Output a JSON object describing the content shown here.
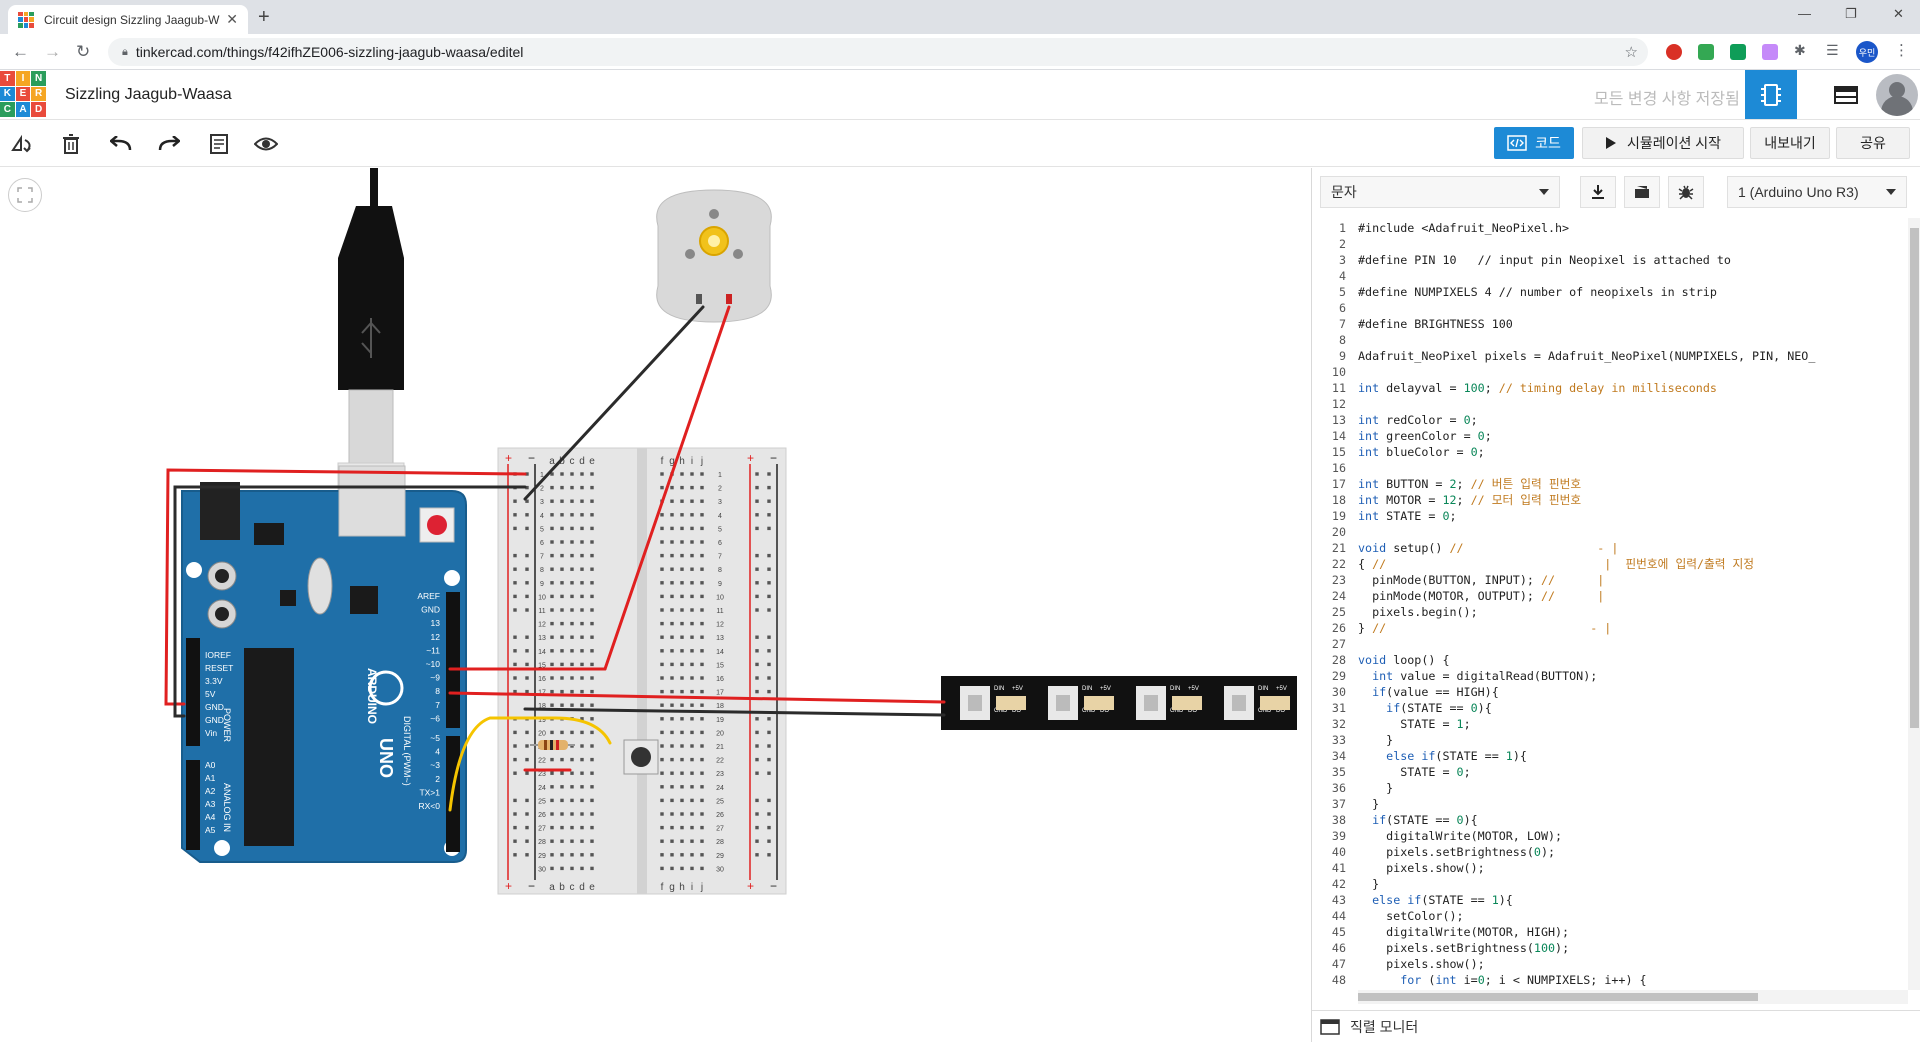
{
  "browser": {
    "tab_title": "Circuit design Sizzling Jaagub-W",
    "url": "tinkercad.com/things/f42ifhZE006-sizzling-jaagub-waasa/editel"
  },
  "header": {
    "logo_letters": [
      "T",
      "I",
      "N",
      "K",
      "E",
      "R",
      "C",
      "A",
      "D"
    ],
    "project_name": "Sizzling Jaagub-Waasa",
    "save_status": "모든 변경 사항 저장됨",
    "profile_badge": "우민"
  },
  "toolbar": {
    "code_label": "코드",
    "simulate_label": "시뮬레이션 시작",
    "export_label": "내보내기",
    "share_label": "공유"
  },
  "code_panel": {
    "mode_select": "문자",
    "device_select": "1 (Arduino Uno R3)",
    "serial_monitor": "직렬 모니터"
  },
  "circuit": {
    "arduino": {
      "brand": "ARDUINO",
      "model": "UNO",
      "power_labels": [
        "IOREF",
        "RESET",
        "3.3V",
        "5V",
        "GND",
        "GND",
        "Vin"
      ],
      "analog_labels": [
        "A0",
        "A1",
        "A2",
        "A3",
        "A4",
        "A5"
      ],
      "digital_labels": [
        "AREF",
        "GND",
        "13",
        "12",
        "~11",
        "~10",
        "~9",
        "8",
        "7",
        "~6",
        "~5",
        "4",
        "~3",
        "2",
        "TX>1",
        "RX<0"
      ],
      "power_caption": "POWER",
      "analog_caption": "ANALOG IN",
      "digital_caption": "DIGITAL (PWM~)"
    },
    "breadboard": {
      "cols_left": [
        "a",
        "b",
        "c",
        "d",
        "e"
      ],
      "cols_right": [
        "f",
        "g",
        "h",
        "i",
        "j"
      ],
      "rows": 30
    },
    "neopixel_pins": [
      "DIN",
      "+5V",
      "GND",
      "DO"
    ]
  },
  "code_lines": [
    [
      {
        "t": "#include <Adafruit_NeoPixel.h>",
        "c": ""
      }
    ],
    [],
    [
      {
        "t": "#define PIN 10   // input pin Neopixel is attached to",
        "c": ""
      }
    ],
    [],
    [
      {
        "t": "#define NUMPIXELS 4 // number of neopixels in strip",
        "c": ""
      }
    ],
    [],
    [
      {
        "t": "#define BRIGHTNESS 100",
        "c": ""
      }
    ],
    [],
    [
      {
        "t": "Adafruit_NeoPixel pixels = Adafruit_NeoPixel(NUMPIXELS, PIN, NEO_",
        "c": ""
      }
    ],
    [],
    [
      {
        "t": "int",
        "c": "kw"
      },
      {
        "t": " delayval = ",
        "c": ""
      },
      {
        "t": "100",
        "c": "num"
      },
      {
        "t": "; ",
        "c": ""
      },
      {
        "t": "// timing delay in milliseconds",
        "c": "cm"
      }
    ],
    [],
    [
      {
        "t": "int",
        "c": "kw"
      },
      {
        "t": " redColor = ",
        "c": ""
      },
      {
        "t": "0",
        "c": "num"
      },
      {
        "t": ";",
        "c": ""
      }
    ],
    [
      {
        "t": "int",
        "c": "kw"
      },
      {
        "t": " greenColor = ",
        "c": ""
      },
      {
        "t": "0",
        "c": "num"
      },
      {
        "t": ";",
        "c": ""
      }
    ],
    [
      {
        "t": "int",
        "c": "kw"
      },
      {
        "t": " blueColor = ",
        "c": ""
      },
      {
        "t": "0",
        "c": "num"
      },
      {
        "t": ";",
        "c": ""
      }
    ],
    [],
    [
      {
        "t": "int",
        "c": "kw"
      },
      {
        "t": " BUTTON = ",
        "c": ""
      },
      {
        "t": "2",
        "c": "num"
      },
      {
        "t": "; ",
        "c": ""
      },
      {
        "t": "// 버튼 입력 핀번호",
        "c": "cm"
      }
    ],
    [
      {
        "t": "int",
        "c": "kw"
      },
      {
        "t": " MOTOR = ",
        "c": ""
      },
      {
        "t": "12",
        "c": "num"
      },
      {
        "t": "; ",
        "c": ""
      },
      {
        "t": "// 모터 입력 핀번호",
        "c": "cm"
      }
    ],
    [
      {
        "t": "int",
        "c": "kw"
      },
      {
        "t": " STATE = ",
        "c": ""
      },
      {
        "t": "0",
        "c": "num"
      },
      {
        "t": ";",
        "c": ""
      }
    ],
    [],
    [
      {
        "t": "void",
        "c": "kw"
      },
      {
        "t": " setup() ",
        "c": ""
      },
      {
        "t": "//                   - |",
        "c": "cm"
      }
    ],
    [
      {
        "t": "{ ",
        "c": ""
      },
      {
        "t": "//                               |  핀번호에 입력/출력 지정",
        "c": "cm"
      }
    ],
    [
      {
        "t": "  pinMode(BUTTON, INPUT); ",
        "c": ""
      },
      {
        "t": "//      |",
        "c": "cm"
      }
    ],
    [
      {
        "t": "  pinMode(MOTOR, OUTPUT); ",
        "c": ""
      },
      {
        "t": "//      |",
        "c": "cm"
      }
    ],
    [
      {
        "t": "  pixels.begin();",
        "c": ""
      }
    ],
    [
      {
        "t": "} ",
        "c": ""
      },
      {
        "t": "//                             - |",
        "c": "cm"
      }
    ],
    [],
    [
      {
        "t": "void",
        "c": "kw"
      },
      {
        "t": " loop() {",
        "c": ""
      }
    ],
    [
      {
        "t": "  ",
        "c": ""
      },
      {
        "t": "int",
        "c": "kw"
      },
      {
        "t": " value = digitalRead(BUTTON);",
        "c": ""
      }
    ],
    [
      {
        "t": "  ",
        "c": ""
      },
      {
        "t": "if",
        "c": "kw"
      },
      {
        "t": "(value == HIGH){",
        "c": ""
      }
    ],
    [
      {
        "t": "    ",
        "c": ""
      },
      {
        "t": "if",
        "c": "kw"
      },
      {
        "t": "(STATE == ",
        "c": ""
      },
      {
        "t": "0",
        "c": "num"
      },
      {
        "t": "){",
        "c": ""
      }
    ],
    [
      {
        "t": "      STATE = ",
        "c": ""
      },
      {
        "t": "1",
        "c": "num"
      },
      {
        "t": ";",
        "c": ""
      }
    ],
    [
      {
        "t": "    }",
        "c": ""
      }
    ],
    [
      {
        "t": "    ",
        "c": ""
      },
      {
        "t": "else if",
        "c": "kw"
      },
      {
        "t": "(STATE == ",
        "c": ""
      },
      {
        "t": "1",
        "c": "num"
      },
      {
        "t": "){",
        "c": ""
      }
    ],
    [
      {
        "t": "      STATE = ",
        "c": ""
      },
      {
        "t": "0",
        "c": "num"
      },
      {
        "t": ";",
        "c": ""
      }
    ],
    [
      {
        "t": "    }",
        "c": ""
      }
    ],
    [
      {
        "t": "  }",
        "c": ""
      }
    ],
    [
      {
        "t": "  ",
        "c": ""
      },
      {
        "t": "if",
        "c": "kw"
      },
      {
        "t": "(STATE == ",
        "c": ""
      },
      {
        "t": "0",
        "c": "num"
      },
      {
        "t": "){",
        "c": ""
      }
    ],
    [
      {
        "t": "    digitalWrite(MOTOR, LOW);",
        "c": ""
      }
    ],
    [
      {
        "t": "    pixels.setBrightness(",
        "c": ""
      },
      {
        "t": "0",
        "c": "num"
      },
      {
        "t": ");",
        "c": ""
      }
    ],
    [
      {
        "t": "    pixels.show();",
        "c": ""
      }
    ],
    [
      {
        "t": "  }",
        "c": ""
      }
    ],
    [
      {
        "t": "  ",
        "c": ""
      },
      {
        "t": "else if",
        "c": "kw"
      },
      {
        "t": "(STATE == ",
        "c": ""
      },
      {
        "t": "1",
        "c": "num"
      },
      {
        "t": "){",
        "c": ""
      }
    ],
    [
      {
        "t": "    setColor();",
        "c": ""
      }
    ],
    [
      {
        "t": "    digitalWrite(MOTOR, HIGH);",
        "c": ""
      }
    ],
    [
      {
        "t": "    pixels.setBrightness(",
        "c": ""
      },
      {
        "t": "100",
        "c": "num"
      },
      {
        "t": ");",
        "c": ""
      }
    ],
    [
      {
        "t": "    pixels.show();",
        "c": ""
      }
    ],
    [
      {
        "t": "      ",
        "c": ""
      },
      {
        "t": "for",
        "c": "kw"
      },
      {
        "t": " (",
        "c": ""
      },
      {
        "t": "int",
        "c": "kw"
      },
      {
        "t": " i=",
        "c": ""
      },
      {
        "t": "0",
        "c": "num"
      },
      {
        "t": "; i < NUMPIXELS; i++) {",
        "c": ""
      }
    ]
  ],
  "colors": {
    "accent": "#1d8ad6",
    "arduino_board": "#1f6fa8",
    "wire_red": "#e02020",
    "wire_black": "#2b2b2b",
    "wire_yellow": "#f5c400",
    "strip": "#111111"
  },
  "icons": {
    "rotate": "rotate-icon",
    "delete": "trash-icon",
    "undo": "undo-icon",
    "redo": "redo-icon",
    "notes": "notes-icon",
    "visibility": "eye-icon",
    "download": "download-icon",
    "library": "library-icon",
    "debugger": "bug-icon",
    "fit": "fit-view-icon",
    "serial": "serial-monitor-icon"
  }
}
